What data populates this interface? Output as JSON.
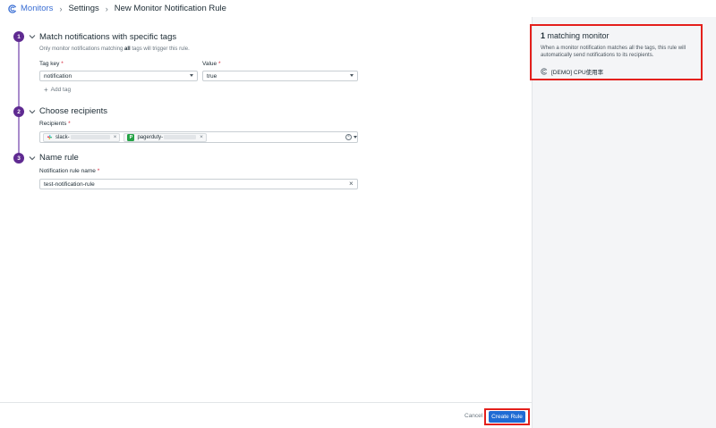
{
  "breadcrumb": {
    "root": "Monitors",
    "middle": "Settings",
    "current": "New Monitor Notification Rule"
  },
  "steps": [
    {
      "number": "1",
      "title": "Match notifications with specific tags"
    },
    {
      "number": "2",
      "title": "Choose recipients"
    },
    {
      "number": "3",
      "title": "Name rule"
    }
  ],
  "tags": {
    "helper_prefix": "Only monitor notifications matching ",
    "helper_bold": "all",
    "helper_suffix": " tags will trigger this rule.",
    "key_label": "Tag key",
    "value_label": "Value",
    "required_mark": "*",
    "key_value": "notification",
    "value_value": "true",
    "add_tag_label": "Add tag"
  },
  "recipients": {
    "label": "Recipients",
    "chips": [
      {
        "prefix": "slack-",
        "icon": "slack-icon"
      },
      {
        "prefix": "pagerduty-",
        "icon": "pagerduty-icon",
        "icon_letter": "P"
      }
    ],
    "remove_glyph": "×"
  },
  "name_rule": {
    "label": "Notification rule name",
    "value": "test-notification-rule"
  },
  "footer": {
    "cancel_label": "Cancel",
    "create_label": "Create Rule"
  },
  "side_panel": {
    "count": "1",
    "title_suffix": " matching monitor",
    "description": "When a monitor notification matches all the tags, this rule will automatically send notifications to its recipients.",
    "monitors": [
      "[DEMO] CPU使用率"
    ]
  },
  "colors": {
    "accent": "#5f2a91",
    "primary_button": "#1f6bd4",
    "highlight": "#e4201c",
    "link": "#3b6fd4"
  }
}
